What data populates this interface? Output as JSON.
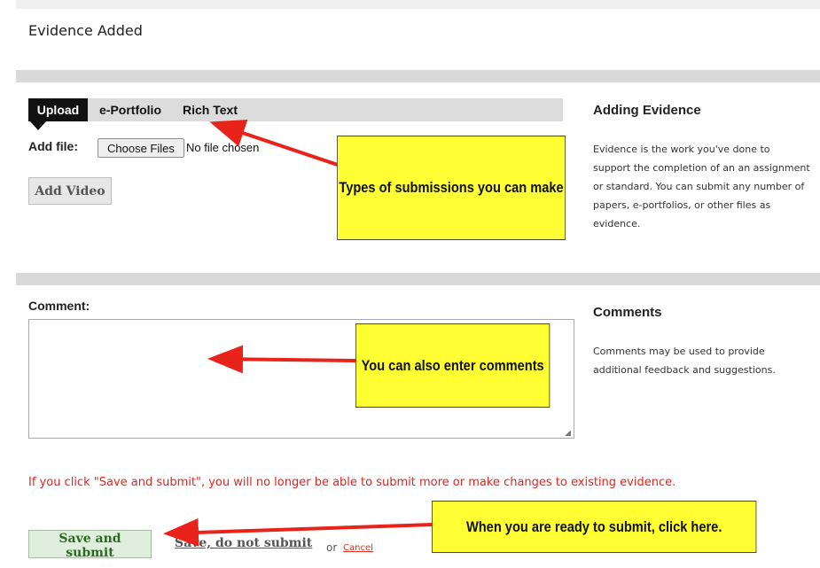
{
  "header": {
    "title": "Evidence Added"
  },
  "tabs": [
    {
      "label": "Upload",
      "active": true
    },
    {
      "label": "e-Portfolio",
      "active": false
    },
    {
      "label": "Rich Text",
      "active": false
    }
  ],
  "upload": {
    "add_file_label": "Add file:",
    "choose_files_label": "Choose Files",
    "no_file_text": "No file chosen",
    "add_video_label": "Add Video"
  },
  "help": {
    "evidence_title": "Adding Evidence",
    "evidence_text": "Evidence is the work you've done to support the completion of an an assignment or standard. You can submit any number of papers, e-portfolios, or other files as evidence.",
    "comments_title": "Comments",
    "comments_text": "Comments may be used to provide additional feedback and suggestions."
  },
  "comment": {
    "label": "Comment:",
    "value": ""
  },
  "warning_text": "If you click \"Save and submit\", you will no longer be able to submit more or make changes to existing evidence.",
  "actions": {
    "save_submit_label": "Save and submit",
    "save_no_submit_label": "Save, do not submit",
    "or_text": "or",
    "cancel_label": "Cancel"
  },
  "annotations": {
    "note1": "Types of submissions you can make",
    "note2": "You can also enter comments",
    "note3": "When you are ready to submit, click here."
  },
  "colors": {
    "annotation_bg": "#ffff33",
    "arrow": "#e8231b",
    "warning": "#e8231b",
    "active_tab": "#111111"
  }
}
